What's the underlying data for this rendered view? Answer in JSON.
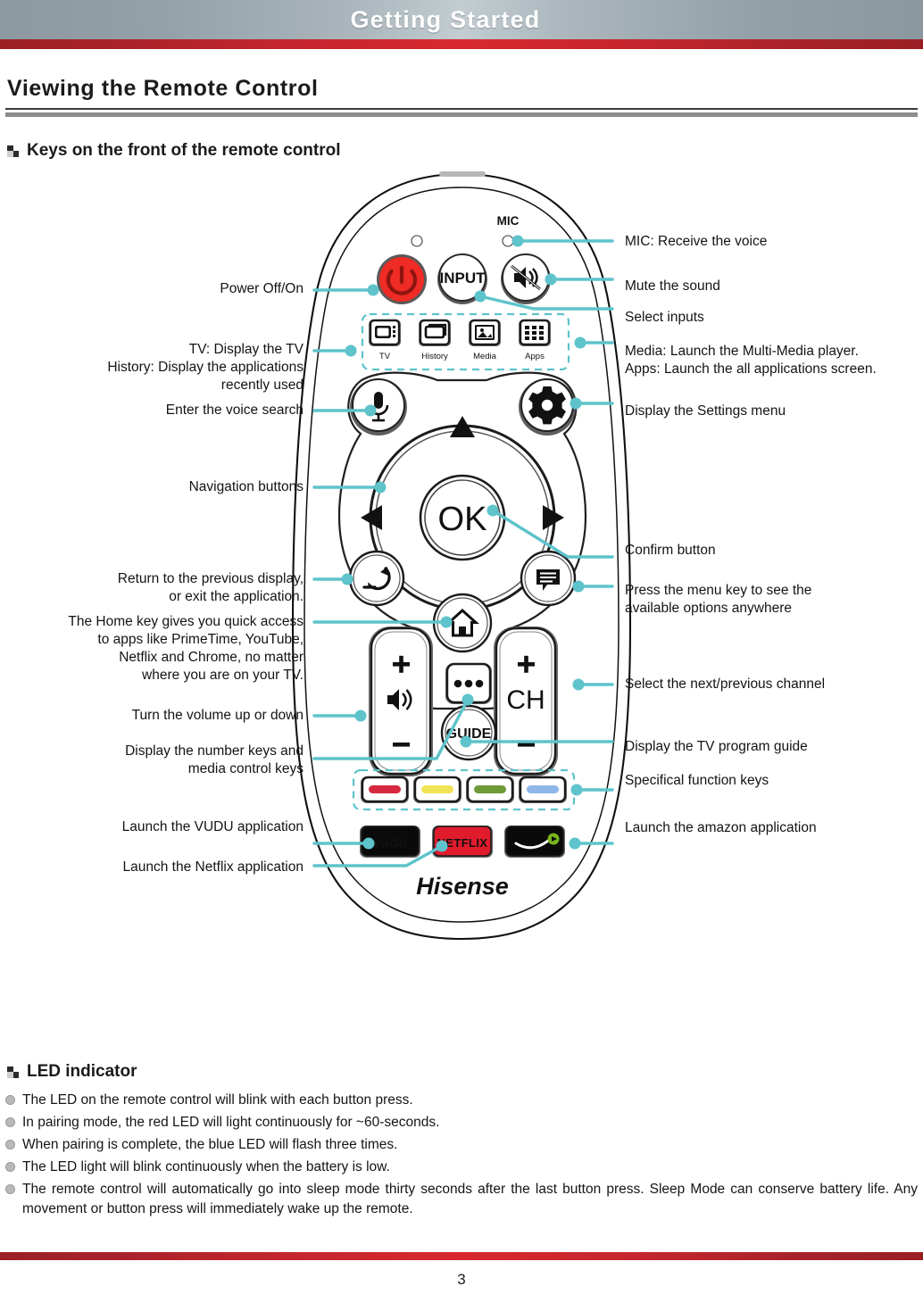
{
  "banner": {
    "title": "Getting Started"
  },
  "section": {
    "heading": "Viewing the Remote Control"
  },
  "subheadings": {
    "keys": "Keys on the front of the remote control",
    "led": "LED indicator"
  },
  "callouts": {
    "left": [
      {
        "id": "power",
        "text": "Power Off/On"
      },
      {
        "id": "tv-history",
        "text": "TV: Display the TV\nHistory: Display the applications\nrecently used"
      },
      {
        "id": "voice",
        "text": "Enter the voice search"
      },
      {
        "id": "navigation",
        "text": "Navigation buttons"
      },
      {
        "id": "back",
        "text": "Return to the previous display,\nor exit the application."
      },
      {
        "id": "home",
        "text": "The Home key gives you quick access\nto apps like PrimeTime,  YouTube,\nNetflix and Chrome, no matter\nwhere you are on your TV."
      },
      {
        "id": "volume",
        "text": "Turn the volume up or down"
      },
      {
        "id": "numkeys",
        "text": "Display the number keys and\nmedia control keys"
      },
      {
        "id": "vudu",
        "text": "Launch the VUDU application"
      },
      {
        "id": "netflix",
        "text": "Launch the Netflix application"
      }
    ],
    "right": [
      {
        "id": "mic",
        "text": "MIC: Receive the voice"
      },
      {
        "id": "mute",
        "text": "Mute the sound"
      },
      {
        "id": "input",
        "text": "Select inputs"
      },
      {
        "id": "media-apps",
        "text": "Media: Launch the Multi-Media player.\nApps: Launch the all applications screen."
      },
      {
        "id": "settings",
        "text": "Display the Settings menu"
      },
      {
        "id": "ok",
        "text": "Confirm button"
      },
      {
        "id": "menu",
        "text": "Press the menu key to see the\navailable options anywhere"
      },
      {
        "id": "channel",
        "text": "Select the next/previous channel"
      },
      {
        "id": "guide",
        "text": "Display the TV program guide"
      },
      {
        "id": "colorkeys",
        "text": "Specifical function keys"
      },
      {
        "id": "amazon",
        "text": "Launch the amazon application"
      }
    ]
  },
  "remote": {
    "mic_label": "MIC",
    "input_label": "INPUT",
    "ok_label": "OK",
    "guide_label": "GUIDE",
    "ch_label": "CH",
    "brand": "Hisense",
    "shortcut_labels": [
      "TV",
      "History",
      "Media",
      "Apps"
    ],
    "app_buttons": [
      "vudu",
      "NETFLIX",
      "amazon"
    ],
    "color_keys": [
      "#d6293f",
      "#f2e356",
      "#6e9a38",
      "#8fb6e8"
    ],
    "accent_color": "#5ec3cb",
    "power_color": "#ee2b24",
    "netflix_color": "#e01b2c"
  },
  "led": {
    "items": [
      "The LED on the remote control will blink with each button press.",
      "In pairing mode, the red LED will light continuously for ~60-seconds.",
      "When pairing is complete, the blue LED will flash three times.",
      "The LED light will blink continuously when the battery is low.",
      "The remote control will automatically go into sleep mode thirty seconds after the last button press. Sleep Mode can conserve battery life. Any movement or button press will immediately wake up the remote."
    ]
  },
  "footer": {
    "page_number": "3"
  }
}
